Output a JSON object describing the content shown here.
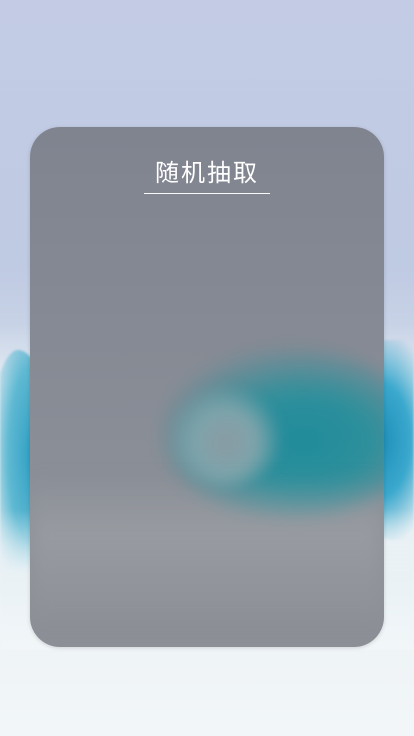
{
  "card": {
    "title": "随机抽取"
  }
}
